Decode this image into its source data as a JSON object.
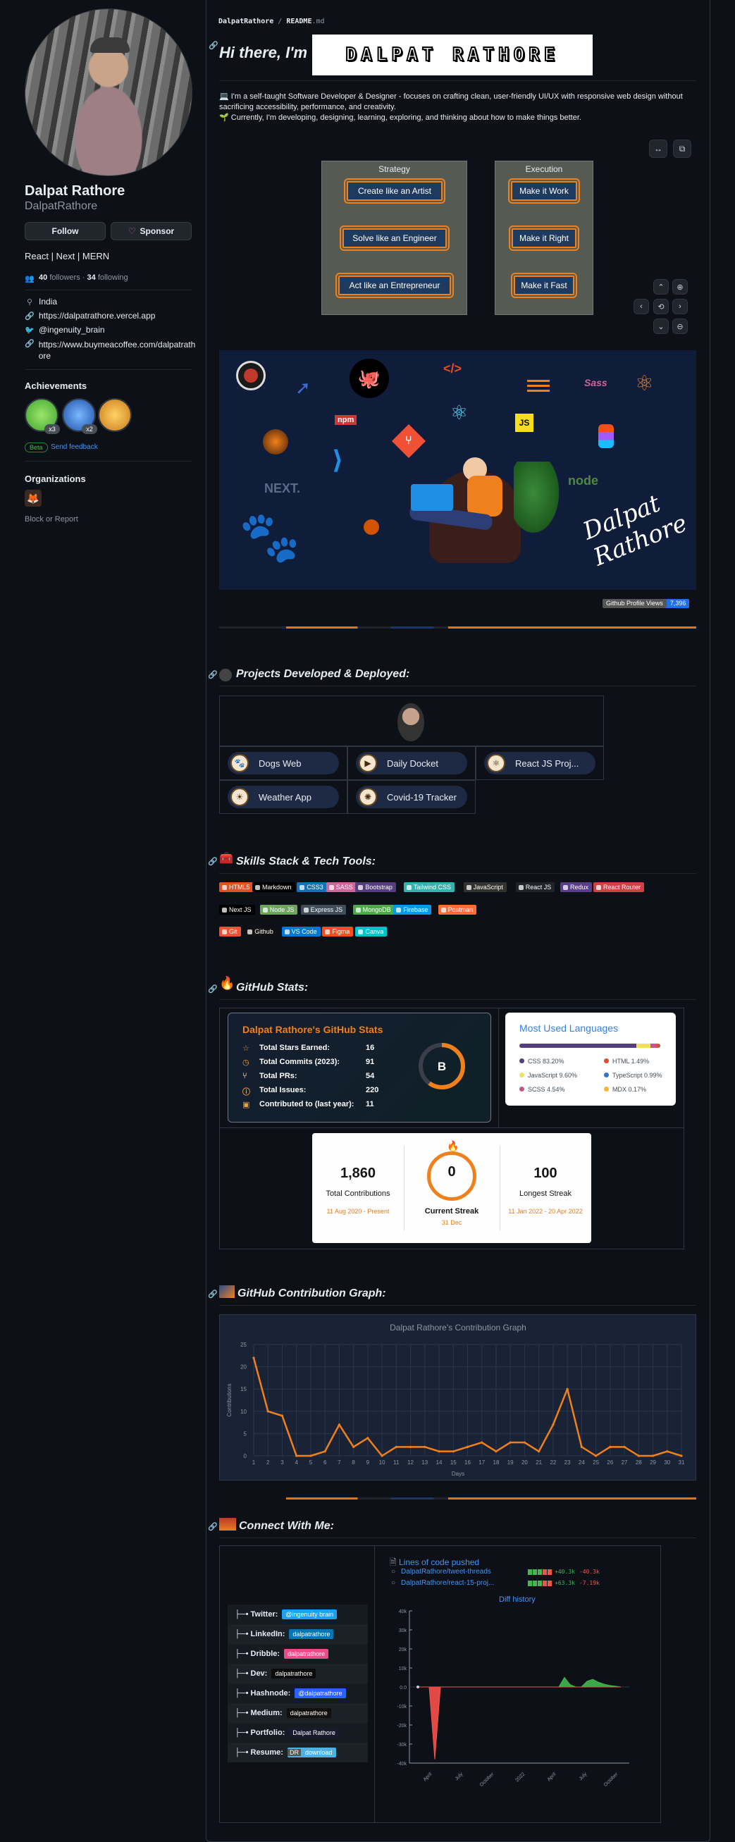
{
  "profile": {
    "name": "Dalpat Rathore",
    "login": "DalpatRathore",
    "follow_label": "Follow",
    "sponsor_label": "Sponsor",
    "bio": "React | Next | MERN",
    "followers": "40",
    "followers_label": "followers",
    "following": "34",
    "following_label": "following",
    "dot": "·",
    "location": "India",
    "website": "https://dalpatrathore.vercel.app",
    "twitter": "@ingenuity_brain",
    "link2_line1": "https://www.buymeacoffee.com/dalpatrath",
    "link2_line2": "ore",
    "achievements_title": "Achievements",
    "achievement_counts": [
      "x3",
      "x2"
    ],
    "beta_label": "Beta",
    "send_feedback": "Send feedback",
    "organizations_title": "Organizations",
    "block_report": "Block or Report"
  },
  "readme": {
    "breadcrumb_user": "DalpatRathore",
    "breadcrumb_sep": " / ",
    "breadcrumb_file": "README",
    "breadcrumb_ext": ".md",
    "greeting": "Hi there, I'm",
    "banner_name": "DALPAT RATHORE",
    "intro_line1": "💻 I'm a self-taught Software Developer & Designer - focuses on crafting clean, user-friendly UI/UX with responsive web design without",
    "intro_line2": "sacrificing accessibility, performance, and creativity.",
    "intro_line3": "🌱 Currently, I'm developing, designing, learning, exploring, and thinking about how to make things better.",
    "strategy": {
      "title": "Strategy",
      "items": [
        "Create like an Artist",
        "Solve like an Engineer",
        "Act like an Entrepreneur"
      ]
    },
    "execution": {
      "title": "Execution",
      "items": [
        "Make it Work",
        "Make it Right",
        "Make it Fast"
      ]
    },
    "hero_tech": [
      "npm",
      "JS",
      "</>",
      "NEXT.",
      "node"
    ],
    "hero_signature": "Dalpat Rathore",
    "views_label": "Github Profile Views",
    "views_count": "7,396"
  },
  "sections": {
    "projects": "Projects Developed & Deployed:",
    "skills": "Skills Stack & Tech Tools:",
    "stats": "GitHub Stats:",
    "graph": "GitHub Contribution Graph:",
    "connect": "Connect With Me:"
  },
  "projects": [
    "Dogs Web",
    "Daily Docket",
    "React JS Proj...",
    "Weather App",
    "Covid-19 Tracker"
  ],
  "skills": {
    "row1": [
      {
        "label": "HTML5",
        "color": "#e34f26"
      },
      {
        "label": "Markdown",
        "color": "#000000"
      },
      {
        "label": "CSS3",
        "color": "#1572b6"
      },
      {
        "label": "SASS",
        "color": "#cd6799"
      },
      {
        "label": "Bootstrap",
        "color": "#563d7c"
      },
      {
        "label": "Tailwind CSS",
        "color": "#38b2ac"
      },
      {
        "label": "JavaScript",
        "color": "#323330"
      },
      {
        "label": "React JS",
        "color": "#20232a"
      },
      {
        "label": "Redux",
        "color": "#593d88"
      },
      {
        "label": "React Router",
        "color": "#ca4245"
      }
    ],
    "row2": [
      {
        "label": "Next JS",
        "color": "#000000"
      },
      {
        "label": "Node JS",
        "color": "#6da55f"
      },
      {
        "label": "Express JS",
        "color": "#404d59"
      },
      {
        "label": "MongoDB",
        "color": "#4ea94b"
      },
      {
        "label": "Firebase",
        "color": "#039be5"
      },
      {
        "label": "Postman",
        "color": "#ff6c37"
      }
    ],
    "row3": [
      {
        "label": "Git",
        "color": "#f05033"
      },
      {
        "label": "Github",
        "color": "#121011"
      },
      {
        "label": "VS Code",
        "color": "#0078d7"
      },
      {
        "label": "Figma",
        "color": "#f24e1e"
      },
      {
        "label": "Canva",
        "color": "#00c4cc"
      }
    ]
  },
  "stats_card": {
    "title": "Dalpat Rathore's GitHub Stats",
    "rows": [
      {
        "label": "Total Stars Earned:",
        "value": "16",
        "icon": "star-icon"
      },
      {
        "label": "Total Commits (2023):",
        "value": "91",
        "icon": "history-icon"
      },
      {
        "label": "Total PRs:",
        "value": "54",
        "icon": "pr-icon"
      },
      {
        "label": "Total Issues:",
        "value": "220",
        "icon": "issue-icon"
      },
      {
        "label": "Contributed to (last year):",
        "value": "11",
        "icon": "repo-icon"
      }
    ],
    "rank": "B",
    "rank_fill": 0.6
  },
  "languages": {
    "title": "Most Used Languages",
    "items": [
      {
        "name": "CSS",
        "pct": "83.20%",
        "color": "#563d7c"
      },
      {
        "name": "HTML",
        "pct": "1.49%",
        "color": "#e34c26"
      },
      {
        "name": "JavaScript",
        "pct": "9.60%",
        "color": "#f1e05a"
      },
      {
        "name": "TypeScript",
        "pct": "0.99%",
        "color": "#3178c6"
      },
      {
        "name": "SCSS",
        "pct": "4.54%",
        "color": "#c6538c"
      },
      {
        "name": "MDX",
        "pct": "0.17%",
        "color": "#fcb32c"
      }
    ],
    "bar": [
      83.2,
      9.6,
      4.54,
      1.49,
      0.99,
      0.17
    ]
  },
  "streak": {
    "total": "1,860",
    "total_label": "Total Contributions",
    "total_range": "11 Aug 2020 - Present",
    "current": "0",
    "current_label": "Current Streak",
    "current_date": "31 Dec",
    "longest": "100",
    "longest_label": "Longest Streak",
    "longest_range": "11 Jan 2022 - 20 Apr 2022"
  },
  "chart_data": [
    {
      "type": "line",
      "title": "Dalpat Rathore's Contribution Graph",
      "xlabel": "Days",
      "ylabel": "Contributions",
      "x": [
        1,
        2,
        3,
        4,
        5,
        6,
        7,
        8,
        9,
        10,
        11,
        12,
        13,
        14,
        15,
        16,
        17,
        18,
        19,
        20,
        21,
        22,
        23,
        24,
        25,
        26,
        27,
        28,
        29,
        30,
        31
      ],
      "values": [
        22,
        10,
        9,
        0,
        0,
        1,
        7,
        2,
        4,
        0,
        2,
        2,
        2,
        1,
        1,
        2,
        3,
        1,
        3,
        3,
        1,
        7,
        15,
        2,
        0,
        2,
        2,
        0,
        0,
        1,
        0
      ],
      "ylim": [
        0,
        25
      ],
      "yticks": [
        0,
        5,
        10,
        15,
        20,
        25
      ],
      "grid": true,
      "color": "#f0801c"
    },
    {
      "type": "area",
      "title": "Diff history",
      "ylim": [
        -40000,
        40000
      ],
      "yticks": [
        "40k",
        "30k",
        "20k",
        "10k",
        "0.0",
        "-10k",
        "-20k",
        "-30k",
        "-40k"
      ],
      "xticks": [
        "April",
        "July",
        "October",
        "2022",
        "April",
        "July",
        "October"
      ],
      "series": [
        {
          "name": "additions",
          "color": "#3fb950",
          "values": [
            0,
            0,
            0,
            0,
            0,
            0,
            0,
            0,
            0,
            0,
            0,
            0,
            0,
            0,
            0,
            0,
            0,
            0,
            0,
            0,
            0,
            0,
            0,
            0,
            0,
            0,
            5000,
            1200,
            0,
            0,
            3000,
            4000,
            2500,
            1500,
            800,
            400,
            0
          ]
        },
        {
          "name": "deletions",
          "color": "#f85149",
          "values": [
            0,
            0,
            0,
            -38000,
            0,
            0,
            0,
            0,
            0,
            0,
            0,
            0,
            0,
            0,
            0,
            0,
            0,
            0,
            0,
            0,
            0,
            0,
            0,
            0,
            0,
            0,
            0,
            0,
            0,
            0,
            0,
            0,
            0,
            0,
            0,
            0,
            0
          ]
        }
      ]
    }
  ],
  "loc": {
    "title": "Lines of code pushed",
    "repos": [
      {
        "name": "DalpatRathore/tweet-threads",
        "add": "+40.3k",
        "del": "-40.3k"
      },
      {
        "name": "DalpatRathore/react-15-proj...",
        "add": "+63.3k",
        "del": "-7.19k"
      }
    ]
  },
  "social": [
    {
      "label": "Twitter:",
      "badge": "@ingenuity brain",
      "color": "#1ca0f2"
    },
    {
      "label": "LinkedIn:",
      "badge": "dalpatrathore",
      "color": "#0077b5"
    },
    {
      "label": "Dribble:",
      "badge": "dalpatrathore",
      "color": "#ea4c89"
    },
    {
      "label": "Dev:",
      "badge": "dalpatrathore",
      "color": "#0a0a0a"
    },
    {
      "label": "Hashnode:",
      "badge": "@dalpatrathore",
      "color": "#2962ff"
    },
    {
      "label": "Medium:",
      "badge": "dalpatrathore",
      "color": "#12100e"
    },
    {
      "label": "Portfolio:",
      "badge": "Dalpat Rathore",
      "color": "#1a1a2e"
    },
    {
      "label": "Resume:",
      "badge_prefix": "DR",
      "badge": "download",
      "color": "#4eb1e0"
    }
  ]
}
